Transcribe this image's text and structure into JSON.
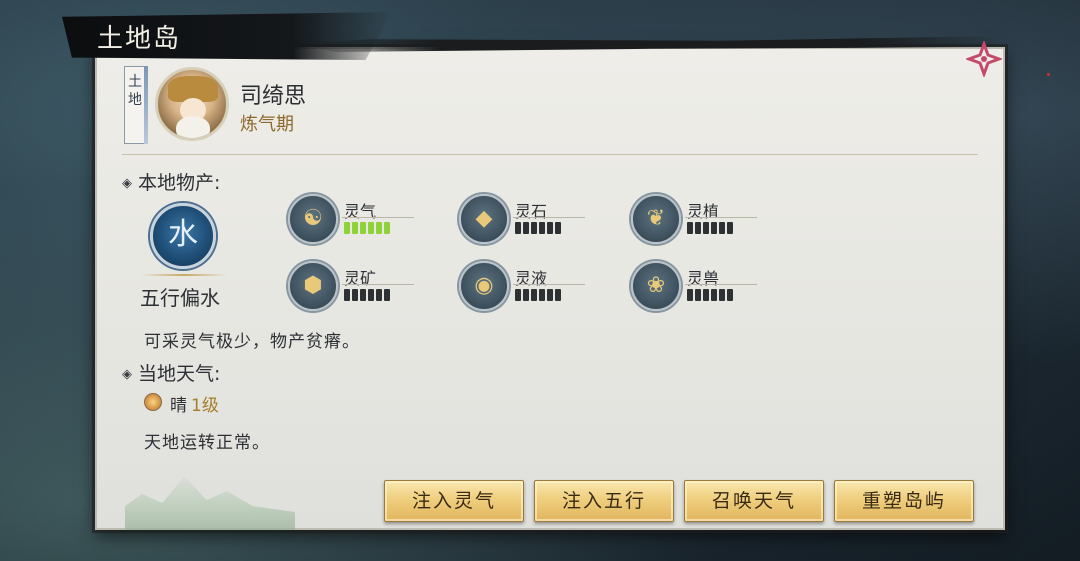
{
  "window": {
    "title": "土地岛"
  },
  "npc": {
    "tag": "土地",
    "name": "司绮思",
    "rank": "炼气期"
  },
  "production": {
    "label": "本地物产:",
    "element": {
      "glyph": "水",
      "name": "五行偏水"
    },
    "resources": [
      {
        "name": "灵气",
        "icon": "spirit-qi-icon",
        "glyph": "☯",
        "level": 6,
        "max": 6,
        "bar_color": "#8fd23a"
      },
      {
        "name": "灵石",
        "icon": "spirit-stone-icon",
        "glyph": "◆",
        "level": 0,
        "max": 6
      },
      {
        "name": "灵植",
        "icon": "spirit-plant-icon",
        "glyph": "❦",
        "level": 0,
        "max": 6
      },
      {
        "name": "灵矿",
        "icon": "spirit-ore-icon",
        "glyph": "⬢",
        "level": 0,
        "max": 6
      },
      {
        "name": "灵液",
        "icon": "spirit-liquid-icon",
        "glyph": "◉",
        "level": 0,
        "max": 6
      },
      {
        "name": "灵兽",
        "icon": "spirit-beast-icon",
        "glyph": "❀",
        "level": 0,
        "max": 6
      }
    ],
    "description": "可采灵气极少，物产贫瘠。"
  },
  "weather": {
    "label": "当地天气:",
    "condition": "晴",
    "level": "1级",
    "description": "天地运转正常。"
  },
  "actions": {
    "inject_qi": "注入灵气",
    "inject_elements": "注入五行",
    "summon_weather": "召唤天气",
    "reshape_island": "重塑岛屿"
  }
}
